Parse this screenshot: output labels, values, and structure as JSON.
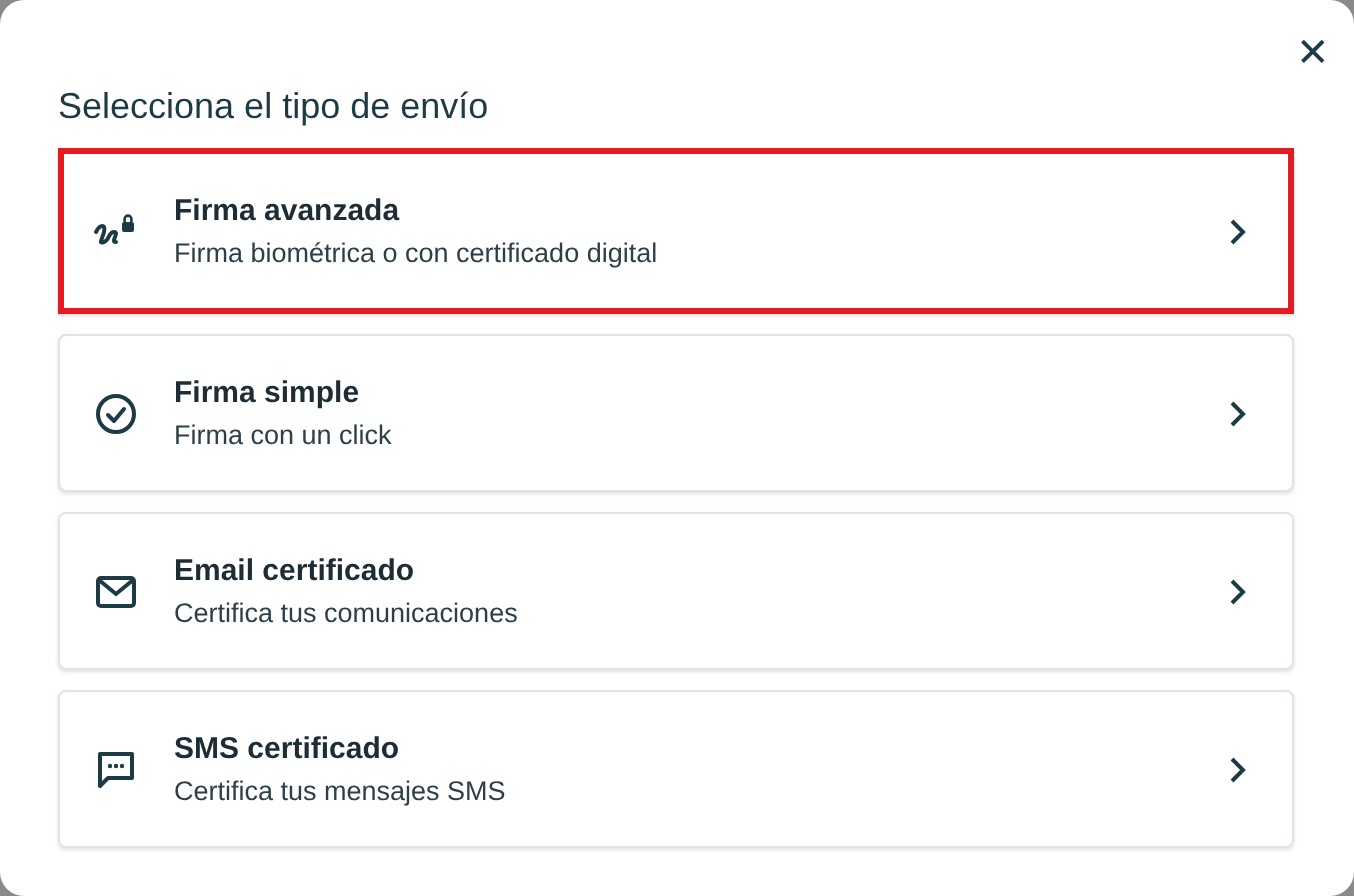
{
  "dialog": {
    "close_icon": "✕",
    "title": "Selecciona el tipo de envío"
  },
  "options": [
    {
      "kind": "signature",
      "title": "Firma avanzada",
      "subtitle": "Firma biométrica o con certificado digital",
      "selected": true
    },
    {
      "kind": "check",
      "title": "Firma simple",
      "subtitle": "Firma con un click",
      "selected": false
    },
    {
      "kind": "email",
      "title": "Email certificado",
      "subtitle": "Certifica tus comunicaciones",
      "selected": false
    },
    {
      "kind": "sms",
      "title": "SMS certificado",
      "subtitle": "Certifica tus mensajes SMS",
      "selected": false
    }
  ]
}
